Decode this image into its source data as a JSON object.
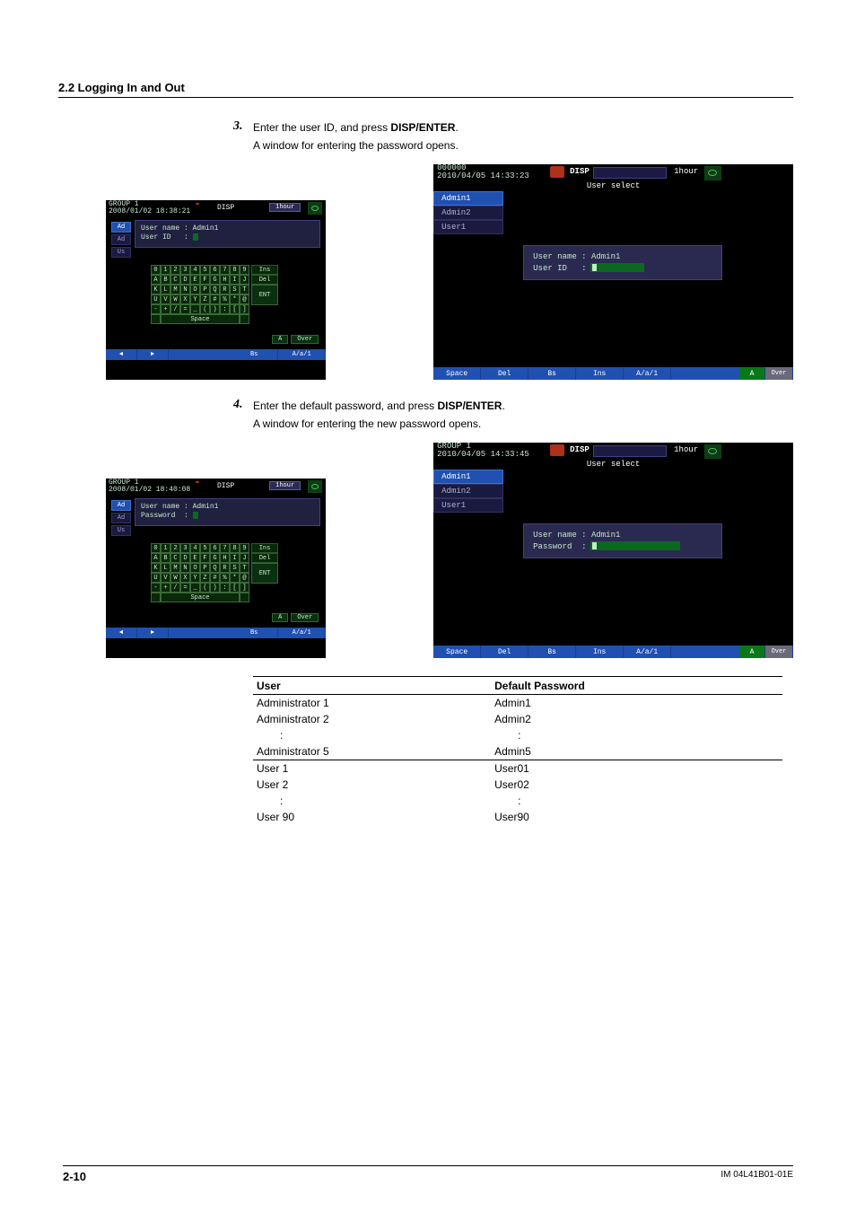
{
  "section_heading": "2.2  Logging In and Out",
  "steps": {
    "s3": {
      "num": "3.",
      "line1_pre": "Enter the user ID, and press ",
      "line1_strong": "DISP/ENTER",
      "line1_post": ".",
      "line2": "A window for entering the password opens."
    },
    "s4": {
      "num": "4.",
      "line1_pre": "Enter the default password, and press ",
      "line1_strong": "DISP/ENTER",
      "line1_post": ".",
      "line2": "A window for entering the new password opens."
    }
  },
  "small1": {
    "group": "GROUP 1",
    "ts": "2008/01/02 18:38:21",
    "disp": "DISP",
    "hour": "1hour",
    "side": [
      "Ad",
      "Ad",
      "Us"
    ],
    "l1": "User name : Admin1",
    "l2": "User ID   :",
    "kb_rows": [
      [
        "0",
        "1",
        "2",
        "3",
        "4",
        "5",
        "6",
        "7",
        "8",
        "9"
      ],
      [
        "A",
        "B",
        "C",
        "D",
        "E",
        "F",
        "G",
        "H",
        "I",
        "J"
      ],
      [
        "K",
        "L",
        "M",
        "N",
        "O",
        "P",
        "Q",
        "R",
        "S",
        "T"
      ],
      [
        "U",
        "V",
        "W",
        "X",
        "Y",
        "Z",
        "#",
        "%",
        "*",
        "@"
      ],
      [
        "-",
        "+",
        "/",
        "=",
        "_",
        "(",
        ")",
        ":",
        "[",
        "]"
      ]
    ],
    "ins": "Ins",
    "del": "Del",
    "ent": "ENT",
    "space": "Space",
    "a_tag": "A",
    "over_tag": "Over",
    "foot": {
      "left": "◄",
      "right": "►",
      "bs": "Bs",
      "aa1": "A/a/1"
    }
  },
  "small2": {
    "group": "GROUP 1",
    "ts": "2008/01/02 18:40:08",
    "disp": "DISP",
    "hour": "1hour",
    "side": [
      "Ad",
      "Ad",
      "Us"
    ],
    "l1": "User name : Admin1",
    "l2": "Password  :",
    "a_tag": "A",
    "over_tag": "Over",
    "foot": {
      "left": "◄",
      "right": "►",
      "bs": "Bs",
      "aa1": "A/a/1"
    }
  },
  "big1": {
    "group": "000000",
    "ts": "2010/04/05 14:33:23",
    "disp": "DISP",
    "hour": "1hour",
    "title": "User select",
    "tabs": [
      "Admin1",
      "Admin2",
      "User1"
    ],
    "p1": "User name : Admin1",
    "p2": "User ID   :",
    "foot": [
      "Space",
      "Del",
      "Bs",
      "Ins",
      "A/a/1"
    ],
    "a": "A",
    "over": "Over"
  },
  "big2": {
    "group": "GROUP 1",
    "ts": "2010/04/05 14:33:45",
    "disp": "DISP",
    "hour": "1hour",
    "title": "User select",
    "tabs": [
      "Admin1",
      "Admin2",
      "User1"
    ],
    "p1": "User name : Admin1",
    "p2": "Password  :",
    "foot": [
      "Space",
      "Del",
      "Bs",
      "Ins",
      "A/a/1"
    ],
    "a": "A",
    "over": "Over"
  },
  "table": {
    "h1": "User",
    "h2": "Default Password",
    "rows": [
      {
        "u": "Administrator 1",
        "p": "Admin1"
      },
      {
        "u": "Administrator 2",
        "p": "Admin2"
      },
      {
        "u": ":",
        "p": ":",
        "dots": true
      },
      {
        "u": "Administrator 5",
        "p": "Admin5",
        "sep": true
      },
      {
        "u": "User 1",
        "p": "User01"
      },
      {
        "u": "User 2",
        "p": "User02"
      },
      {
        "u": ":",
        "p": ":",
        "dots": true
      },
      {
        "u": "User 90",
        "p": "User90"
      }
    ]
  },
  "footer": {
    "page": "2-10",
    "doc": "IM 04L41B01-01E"
  }
}
